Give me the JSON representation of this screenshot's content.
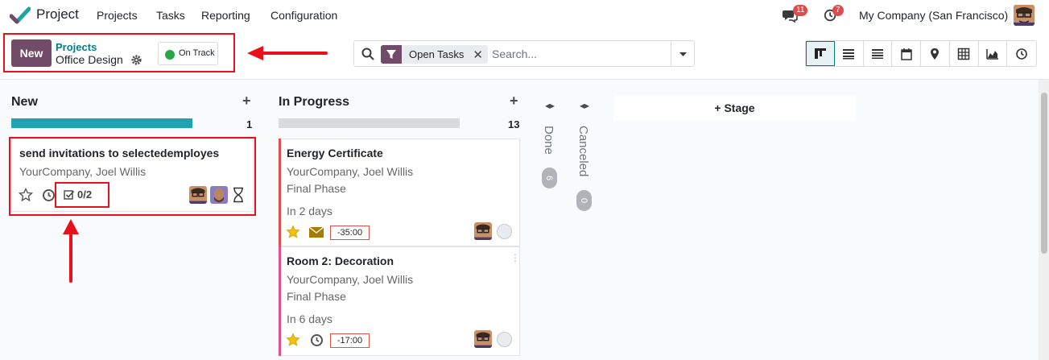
{
  "navbar": {
    "app_name": "Project",
    "menus": [
      "Projects",
      "Tasks",
      "Reporting",
      "Configuration"
    ],
    "messages_badge": "11",
    "activities_badge": "7",
    "company": "My Company (San Francisco)"
  },
  "control_panel": {
    "new_label": "New",
    "breadcrumb_parent": "Projects",
    "breadcrumb_current": "Office Design",
    "status_label": "On Track",
    "status_color": "#28a745",
    "search": {
      "facet_label": "Open Tasks",
      "placeholder": "Search..."
    }
  },
  "columns": [
    {
      "title": "New",
      "count": "1",
      "progress_color": "#21a2b0",
      "cards": [
        {
          "title": "send invitations to selectedemployes",
          "customer": "YourCompany, Joel Willis",
          "subtasks": "0/2"
        }
      ]
    },
    {
      "title": "In Progress",
      "count": "13",
      "progress_color": "#d8dadd",
      "cards": [
        {
          "title": "Energy Certificate",
          "customer": "YourCompany, Joel Willis",
          "stage": "Final Phase",
          "due": "In 2 days",
          "deadline": "-35:00",
          "stripe_color": "#d9534f"
        },
        {
          "title": "Room 2: Decoration",
          "customer": "YourCompany, Joel Willis",
          "stage": "Final Phase",
          "due": "In 6 days",
          "deadline": "-17:00",
          "stripe_color": "#e0528f"
        }
      ]
    }
  ],
  "folded_columns": [
    {
      "title": "Done",
      "count": "6"
    },
    {
      "title": "Canceled",
      "count": "0"
    }
  ],
  "add_stage_label": "Stage",
  "accent_color": "#714b67",
  "annotation_color": "#e8101a"
}
